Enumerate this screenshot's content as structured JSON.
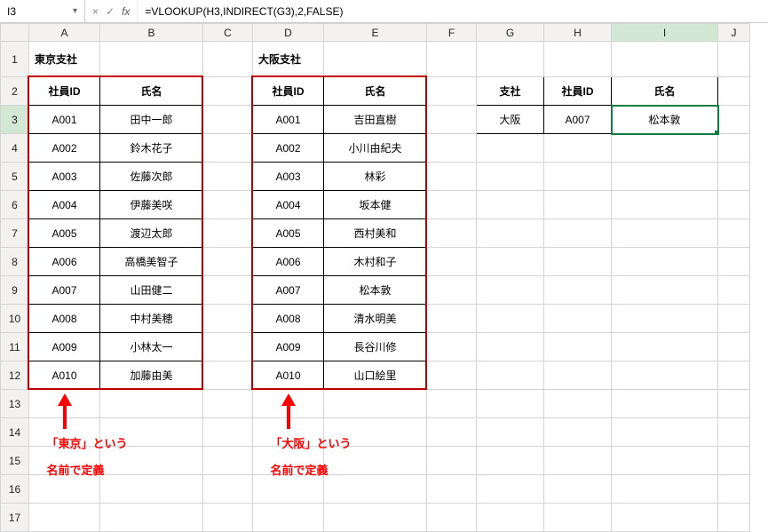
{
  "formula_bar": {
    "name_box": "I3",
    "cancel_icon": "×",
    "confirm_icon": "✓",
    "fx_icon": "fx",
    "formula": "=VLOOKUP(H3,INDIRECT(G3),2,FALSE)"
  },
  "columns": [
    "A",
    "B",
    "C",
    "D",
    "E",
    "F",
    "G",
    "H",
    "I",
    "J"
  ],
  "rows": [
    "1",
    "2",
    "3",
    "4",
    "5",
    "6",
    "7",
    "8",
    "9",
    "10",
    "11",
    "12",
    "13",
    "14",
    "15",
    "16",
    "17"
  ],
  "titles": {
    "tokyo": "東京支社",
    "osaka": "大阪支社"
  },
  "headers": {
    "emp_id": "社員ID",
    "name": "氏名",
    "branch": "支社"
  },
  "tokyo_table": [
    {
      "id": "A001",
      "name": "田中一郎"
    },
    {
      "id": "A002",
      "name": "鈴木花子"
    },
    {
      "id": "A003",
      "name": "佐藤次郎"
    },
    {
      "id": "A004",
      "name": "伊藤美咲"
    },
    {
      "id": "A005",
      "name": "渡辺太郎"
    },
    {
      "id": "A006",
      "name": "高橋美智子"
    },
    {
      "id": "A007",
      "name": "山田健二"
    },
    {
      "id": "A008",
      "name": "中村美穂"
    },
    {
      "id": "A009",
      "name": "小林太一"
    },
    {
      "id": "A010",
      "name": "加藤由美"
    }
  ],
  "osaka_table": [
    {
      "id": "A001",
      "name": "吉田直樹"
    },
    {
      "id": "A002",
      "name": "小川由紀夫"
    },
    {
      "id": "A003",
      "name": "林彩"
    },
    {
      "id": "A004",
      "name": "坂本健"
    },
    {
      "id": "A005",
      "name": "西村美和"
    },
    {
      "id": "A006",
      "name": "木村和子"
    },
    {
      "id": "A007",
      "name": "松本敦"
    },
    {
      "id": "A008",
      "name": "清水明美"
    },
    {
      "id": "A009",
      "name": "長谷川修"
    },
    {
      "id": "A010",
      "name": "山口絵里"
    }
  ],
  "lookup": {
    "branch": "大阪",
    "emp_id": "A007",
    "name": "松本敦"
  },
  "annotations": {
    "tokyo_line1": "「東京」という",
    "tokyo_line2": "名前で定義",
    "osaka_line1": "「大阪」という",
    "osaka_line2": "名前で定義"
  },
  "chart_data": {
    "type": "table",
    "tables": [
      {
        "name": "東京",
        "title": "東京支社",
        "columns": [
          "社員ID",
          "氏名"
        ],
        "rows": [
          [
            "A001",
            "田中一郎"
          ],
          [
            "A002",
            "鈴木花子"
          ],
          [
            "A003",
            "佐藤次郎"
          ],
          [
            "A004",
            "伊藤美咲"
          ],
          [
            "A005",
            "渡辺太郎"
          ],
          [
            "A006",
            "高橋美智子"
          ],
          [
            "A007",
            "山田健二"
          ],
          [
            "A008",
            "中村美穂"
          ],
          [
            "A009",
            "小林太一"
          ],
          [
            "A010",
            "加藤由美"
          ]
        ]
      },
      {
        "name": "大阪",
        "title": "大阪支社",
        "columns": [
          "社員ID",
          "氏名"
        ],
        "rows": [
          [
            "A001",
            "吉田直樹"
          ],
          [
            "A002",
            "小川由紀夫"
          ],
          [
            "A003",
            "林彩"
          ],
          [
            "A004",
            "坂本健"
          ],
          [
            "A005",
            "西村美和"
          ],
          [
            "A006",
            "木村和子"
          ],
          [
            "A007",
            "松本敦"
          ],
          [
            "A008",
            "清水明美"
          ],
          [
            "A009",
            "長谷川修"
          ],
          [
            "A010",
            "山口絵里"
          ]
        ]
      },
      {
        "name": "lookup",
        "columns": [
          "支社",
          "社員ID",
          "氏名"
        ],
        "rows": [
          [
            "大阪",
            "A007",
            "松本敦"
          ]
        ]
      }
    ]
  }
}
